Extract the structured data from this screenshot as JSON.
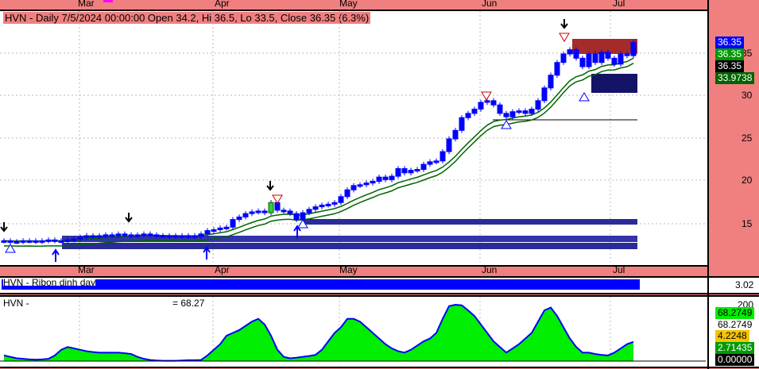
{
  "header": {
    "info": "HVN - Daily 7/5/2024 00:00:00 Open 34.2, Hi 36.5, Lo 33.5, Close 36.35 (6.3%)"
  },
  "months": [
    "Mar",
    "Apr",
    "May",
    "Jun",
    "Jul"
  ],
  "price_axis": [
    "35",
    "30",
    "25",
    "20",
    "15"
  ],
  "price_tags": [
    {
      "value": "36.35",
      "bg": "#0000ff",
      "fg": "#fff"
    },
    {
      "value": "36.35",
      "bg": "#009900",
      "fg": "#fff"
    },
    {
      "value": "36.35",
      "bg": "#000000",
      "fg": "#fff"
    },
    {
      "value": "33.9738",
      "bg": "#006400",
      "fg": "#fff"
    }
  ],
  "ribbon": {
    "label": "HVN - Ribon dinh day",
    "value": "3.02"
  },
  "oscillator": {
    "label": "HVN -",
    "reading": "= 68.27",
    "axis_top": "200",
    "tags": [
      {
        "value": "68.2749",
        "bg": "#00ee00",
        "fg": "#000"
      },
      {
        "value": "68.2749",
        "bg": "#ffffff",
        "fg": "#000"
      },
      {
        "value": "4.2248",
        "bg": "#f5c400",
        "fg": "#000"
      },
      {
        "value": "2.71435",
        "bg": "#009900",
        "fg": "#fff"
      },
      {
        "value": "0.00000",
        "bg": "#000000",
        "fg": "#fff"
      }
    ],
    "values": [
      20,
      15,
      10,
      8,
      6,
      5,
      6,
      8,
      20,
      40,
      50,
      45,
      40,
      35,
      32,
      30,
      30,
      30,
      30,
      28,
      25,
      15,
      8,
      4,
      2,
      1,
      1,
      1,
      2,
      3,
      3,
      4,
      20,
      40,
      60,
      90,
      100,
      110,
      125,
      140,
      150,
      130,
      90,
      40,
      15,
      10,
      12,
      15,
      18,
      22,
      40,
      70,
      100,
      120,
      150,
      150,
      140,
      120,
      100,
      80,
      60,
      45,
      35,
      30,
      40,
      55,
      70,
      80,
      100,
      150,
      195,
      200,
      198,
      180,
      160,
      130,
      100,
      70,
      50,
      30,
      45,
      60,
      80,
      100,
      140,
      180,
      190,
      160,
      120,
      80,
      50,
      30,
      30,
      25,
      22,
      20,
      30,
      45,
      60,
      68
    ]
  },
  "chart_data": {
    "type": "candlestick",
    "ylim": [
      10,
      40
    ],
    "closes": [
      13.0,
      12.9,
      12.9,
      13.0,
      13.0,
      12.9,
      13.0,
      13.1,
      13.0,
      13.0,
      13.1,
      13.2,
      13.4,
      13.6,
      13.5,
      13.6,
      13.7,
      13.6,
      13.8,
      13.7,
      13.6,
      13.7,
      13.8,
      13.7,
      13.6,
      13.6,
      13.5,
      13.6,
      13.5,
      13.6,
      13.5,
      13.8,
      14.2,
      14.3,
      14.5,
      14.6,
      15.5,
      15.8,
      16.2,
      16.4,
      16.5,
      16.3,
      17.5,
      16.6,
      16.5,
      16.2,
      15.5,
      16.3,
      16.7,
      17.0,
      17.2,
      17.3,
      17.5,
      18.2,
      19.0,
      19.5,
      19.6,
      19.8,
      20.0,
      20.5,
      20.2,
      20.6,
      21.5,
      21.0,
      21.3,
      21.4,
      22.0,
      22.3,
      22.4,
      23.5,
      25.0,
      26.0,
      27.5,
      28.0,
      28.5,
      29.3,
      29.5,
      29.0,
      28.0,
      27.6,
      28.2,
      28.3,
      28.0,
      28.5,
      29.5,
      31.0,
      32.5,
      34.0,
      35.0,
      35.5,
      34.5,
      33.5,
      35.0,
      34.0,
      35.2,
      34.5,
      33.8,
      35.0,
      34.8,
      36.35
    ]
  }
}
